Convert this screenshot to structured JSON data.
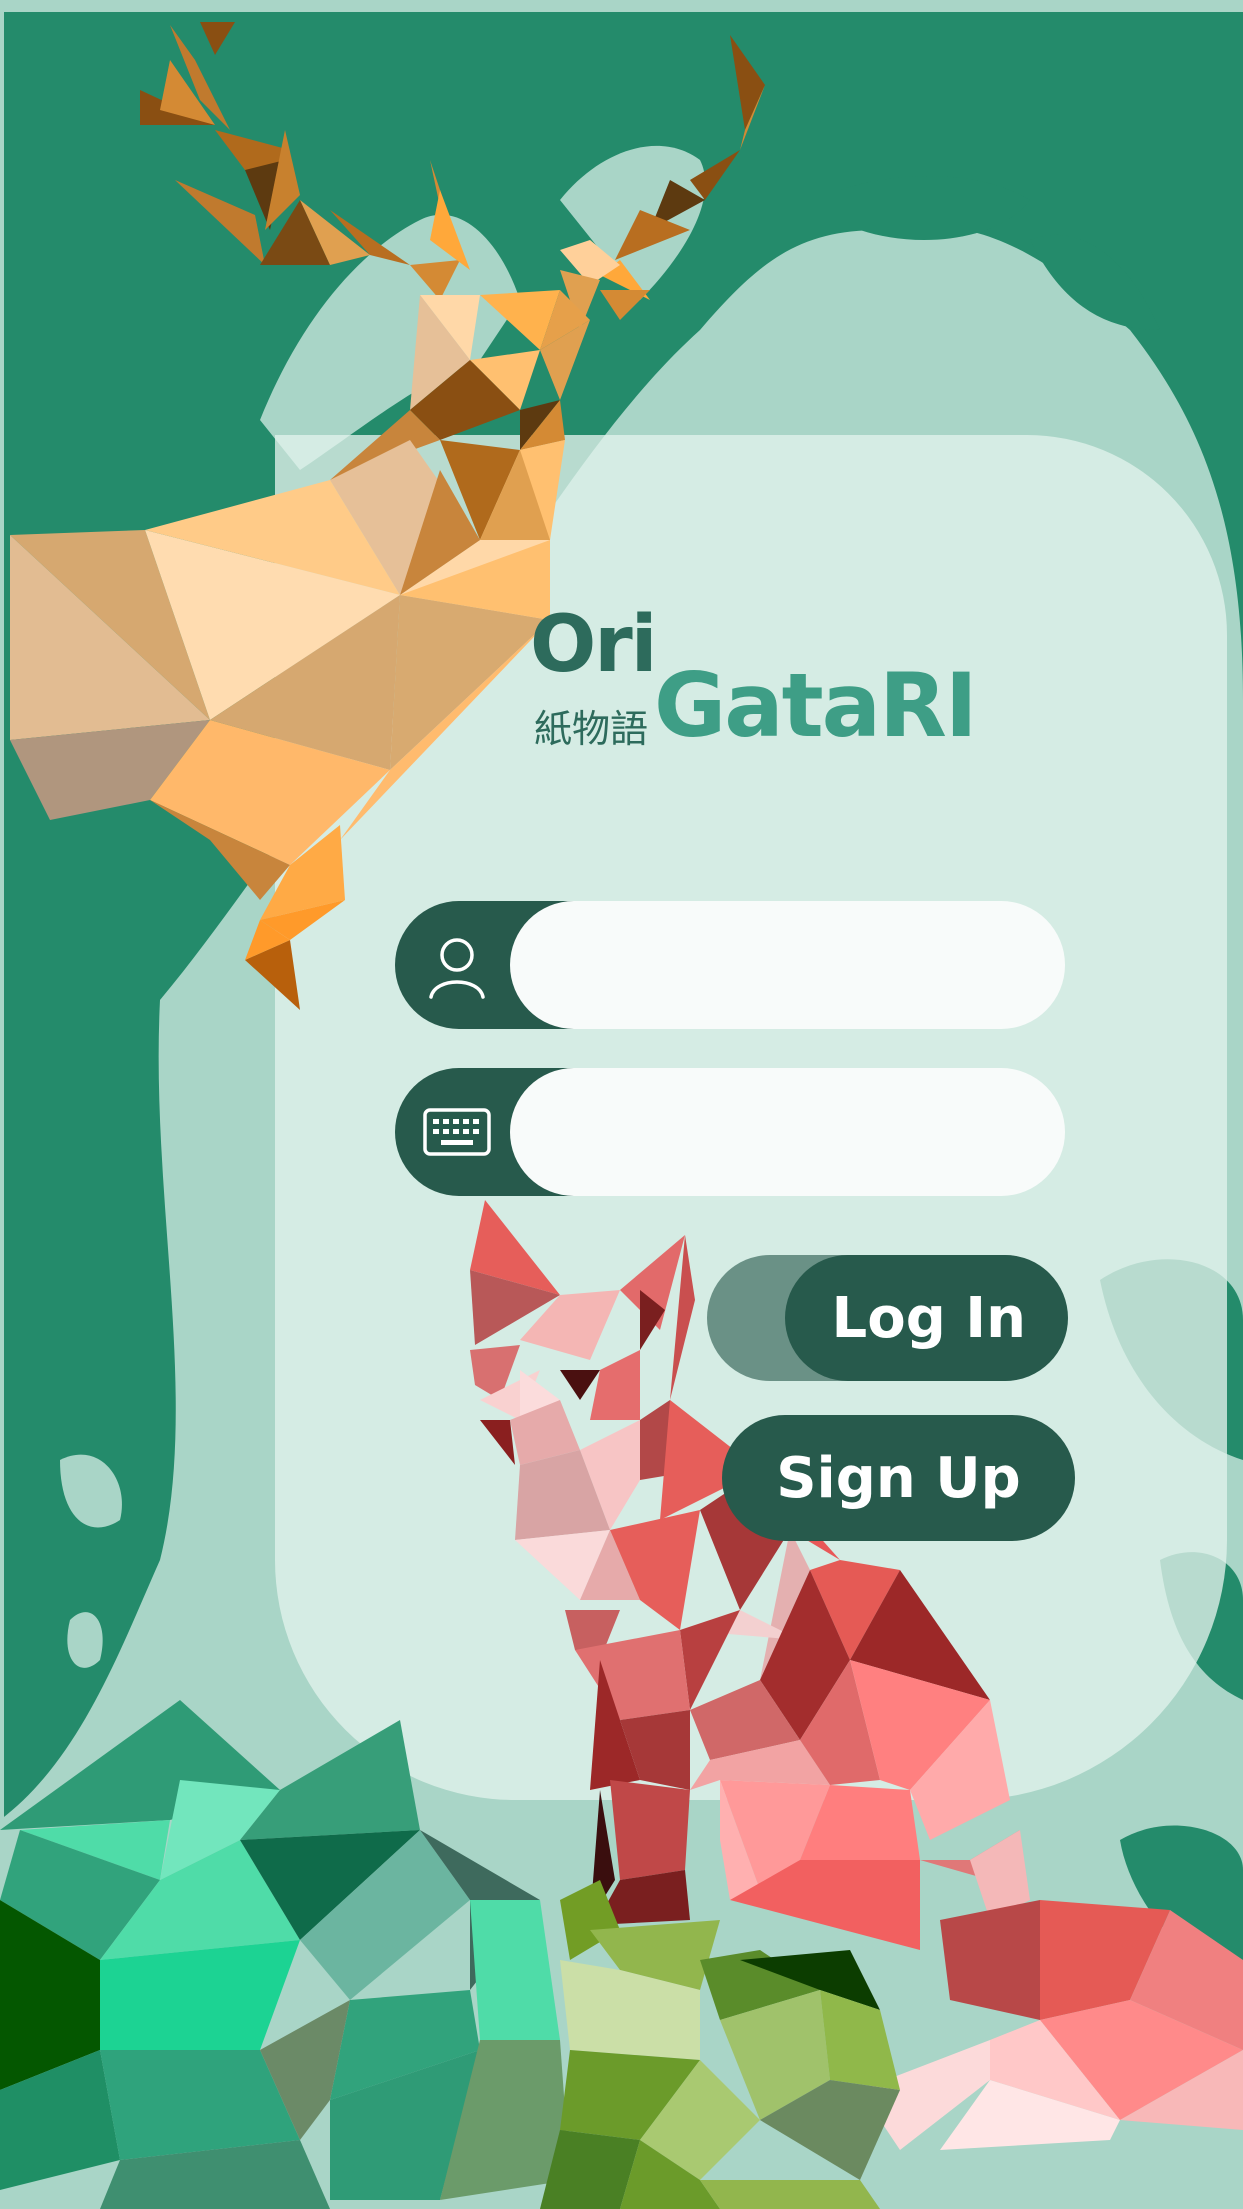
{
  "app": {
    "logo": {
      "ori": "Ori",
      "kanji": "紙物語",
      "gatari": "GataRI"
    }
  },
  "login_form": {
    "username_field": {
      "value": "",
      "placeholder": "",
      "icon": "user-icon"
    },
    "password_field": {
      "value": "",
      "placeholder": "",
      "icon": "keyboard-icon"
    },
    "login_label": "Log In",
    "signup_label": "Sign Up"
  },
  "colors": {
    "background_green": "#248b6b",
    "card": "#d5ece5",
    "button_dark": "#275a4c",
    "logo_dark": "#2d6b5c",
    "logo_light": "#3e9e86"
  }
}
